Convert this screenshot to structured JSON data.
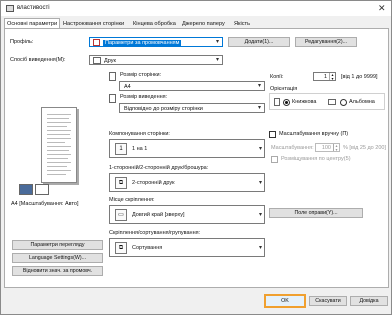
{
  "window": {
    "title": "властивості",
    "close_glyph": "✕"
  },
  "tabs": [
    {
      "label": "Основні параметри"
    },
    {
      "label": "Настроювання сторінки"
    },
    {
      "label": "Кінцева обробка"
    },
    {
      "label": "Джерело паперу"
    },
    {
      "label": "Якість"
    }
  ],
  "profile": {
    "label": "Профіль:",
    "value": "Параметри за промовчанням",
    "add_button": "Додати(1)...",
    "edit_button": "Редагування(2)..."
  },
  "output_method": {
    "label": "Спосіб виведення(M):",
    "value": "Друк"
  },
  "page_size": {
    "label": "Розмір сторінки:",
    "value": "A4"
  },
  "output_size": {
    "label": "Розмір виведення:",
    "value": "Відповідно до розміру сторінки"
  },
  "copies": {
    "label": "Копії:",
    "value": "1",
    "range": "[від 1 до 9999]"
  },
  "orientation": {
    "label": "Орієнтація",
    "portrait": "Книжкова",
    "landscape": "Альбомна",
    "selected": "portrait"
  },
  "layout": {
    "label": "Компонування сторінки:",
    "value": "1 на 1"
  },
  "manual_scaling": {
    "label": "Масштабування вручну (П)",
    "scale_label": "Масштабування:",
    "scale_value": "100",
    "scale_range": "% [від 25 до 200]",
    "center_label": "Розміщування по центру(5)"
  },
  "duplex": {
    "label": "1-сторонній/2-сторонній друк/брошура:",
    "value": "2-сторонній друк"
  },
  "binding": {
    "label": "Місце скріплення:",
    "value": "Довгий край [зверху]",
    "margin_button": "Поле оправи(Y)..."
  },
  "finishing": {
    "label": "Скріплення/сортування/групування:",
    "value": "Сортування"
  },
  "preview": {
    "caption": "A4 [Масштабування: Авто]"
  },
  "side_buttons": {
    "view_settings": "Параметри перегляду",
    "language": "Language Settings(W)...",
    "restore_defaults": "Відновити знач. за промовч."
  },
  "footer": {
    "ok": "OK",
    "cancel": "Скасувати",
    "help": "Довідка"
  },
  "colors": {
    "accent": "#0078d7",
    "ok_highlight": "#f0a030"
  }
}
